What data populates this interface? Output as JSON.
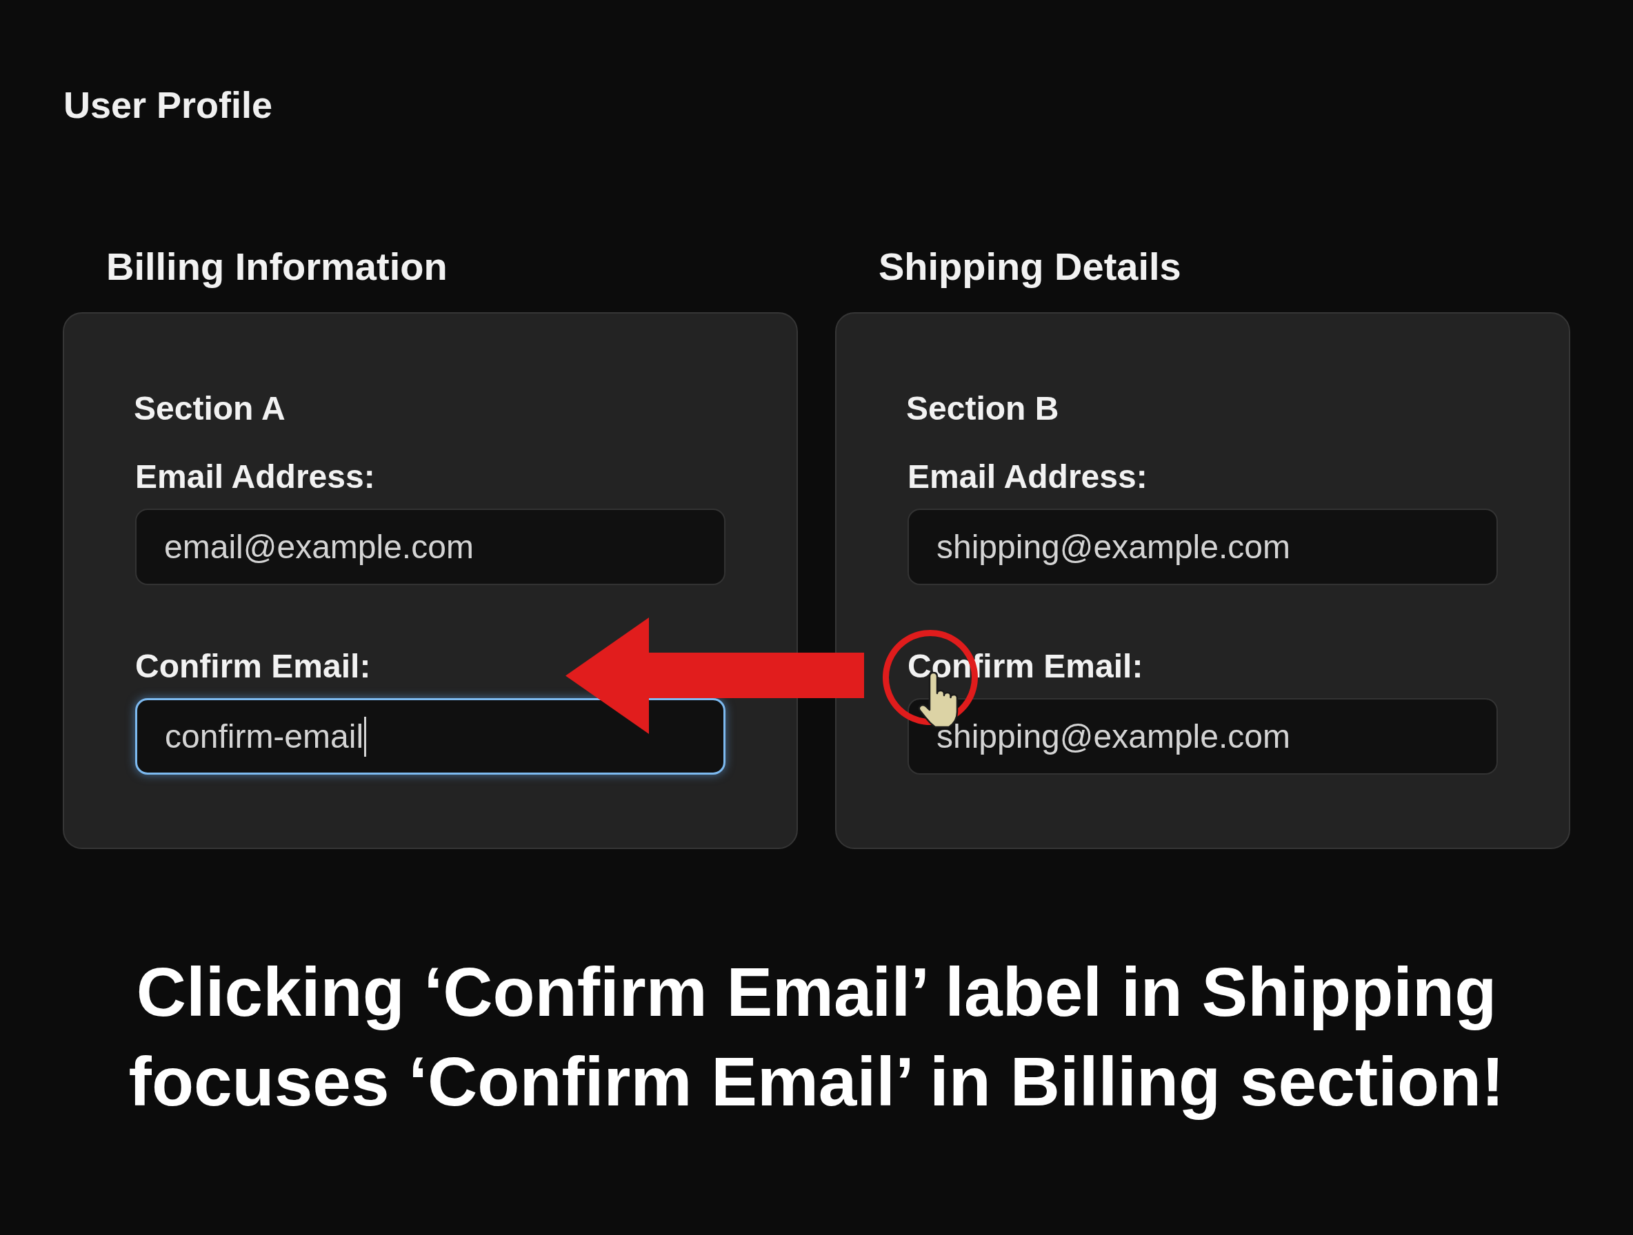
{
  "page": {
    "title": "User Profile"
  },
  "sections": [
    {
      "heading": "Billing Information",
      "card_title": "Section A",
      "fields": [
        {
          "label": "Email Address:",
          "value": "email@example.com",
          "focused": false,
          "clicked": false
        },
        {
          "label": "Confirm Email:",
          "value": "confirm-email",
          "focused": true,
          "clicked": false
        }
      ]
    },
    {
      "heading": "Shipping Details",
      "card_title": "Section B",
      "fields": [
        {
          "label": "Email Address:",
          "value": "shipping@example.com",
          "focused": false,
          "clicked": false
        },
        {
          "label": "Confirm Email:",
          "value": "shipping@example.com",
          "focused": false,
          "clicked": true
        }
      ]
    }
  ],
  "caption": "Clicking ‘Confirm Email’ label in Shipping focuses ‘Confirm Email’ in Billing section!"
}
